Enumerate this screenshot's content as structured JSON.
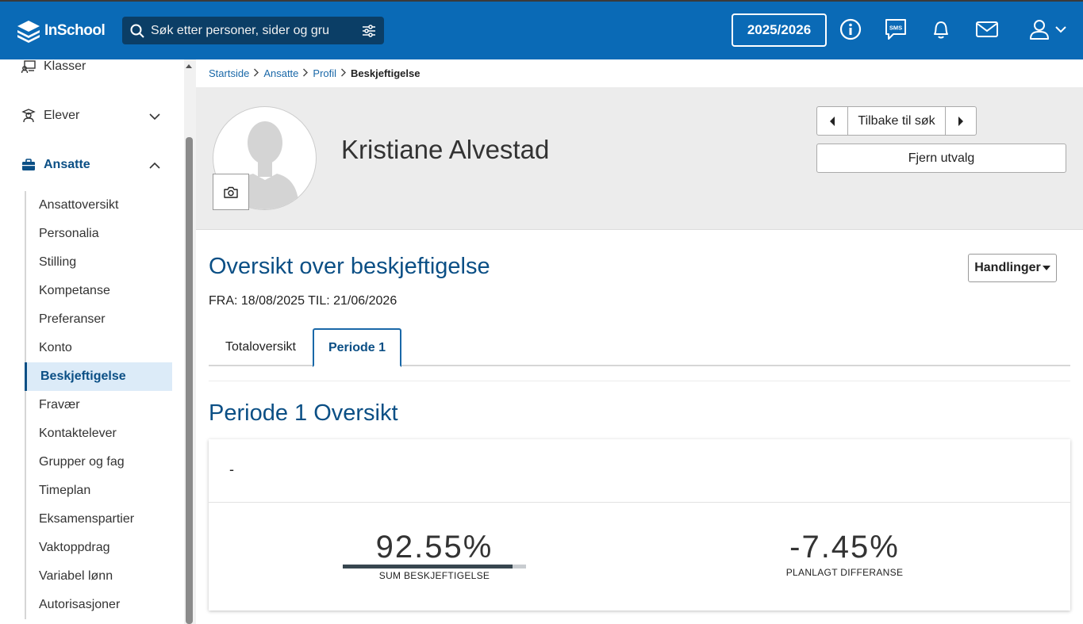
{
  "app": {
    "logo_text": "InSchool",
    "search_placeholder": "Søk etter personer, sider og gru",
    "school_year": "2025/2026",
    "sms_label": "SMS"
  },
  "sidebar": {
    "top_items": [
      {
        "label": "Klasser",
        "icon": "classroom-icon"
      },
      {
        "label": "Elever",
        "icon": "student-icon",
        "expanded": false
      },
      {
        "label": "Ansatte",
        "icon": "briefcase-icon",
        "expanded": true
      }
    ],
    "sub_items": [
      "Ansattoversikt",
      "Personalia",
      "Stilling",
      "Kompetanse",
      "Preferanser",
      "Konto",
      "Beskjeftigelse",
      "Fravær",
      "Kontaktelever",
      "Grupper og fag",
      "Timeplan",
      "Eksamenspartier",
      "Vaktoppdrag",
      "Variabel lønn",
      "Autorisasjoner"
    ],
    "active_sub": "Beskjeftigelse"
  },
  "breadcrumb": {
    "items": [
      "Startside",
      "Ansatte",
      "Profil"
    ],
    "current": "Beskjeftigelse"
  },
  "profile": {
    "name": "Kristiane Alvestad",
    "back_to_search": "Tilbake til søk",
    "clear_selection": "Fjern utvalg"
  },
  "section": {
    "title": "Oversikt over beskjeftigelse",
    "actions_label": "Handlinger",
    "range": "FRA: 18/08/2025 TIL: 21/06/2026",
    "tabs": [
      "Totaloversikt",
      "Periode 1"
    ],
    "active_tab": "Periode 1"
  },
  "period": {
    "title": "Periode 1 Oversikt",
    "card_heading": "-",
    "metrics": [
      {
        "value": "92.55%",
        "label": "SUM BESKJEFTIGELSE",
        "bar_fraction": 0.9255
      },
      {
        "value": "-7.45%",
        "label": "PLANLAGT DIFFERANSE"
      }
    ]
  },
  "colors": {
    "topbar": "#0a6ab6",
    "accent": "#0b4f85",
    "active_bg": "#dcebf8"
  }
}
